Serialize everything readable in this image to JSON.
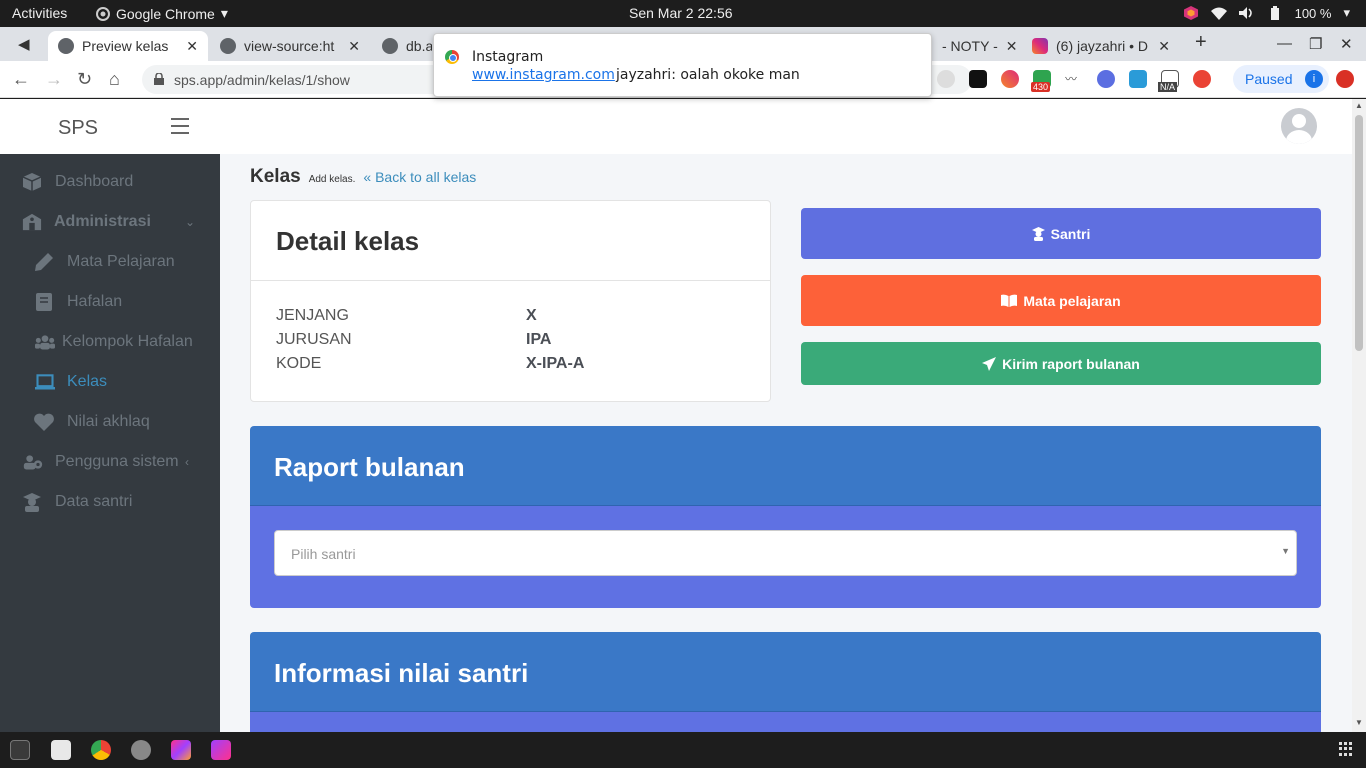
{
  "system": {
    "activities": "Activities",
    "app_name": "Google Chrome",
    "clock": "Sen Mar 2  22:56",
    "battery": "100 %"
  },
  "browser": {
    "tabs": [
      {
        "title": "Preview kelas",
        "active": true
      },
      {
        "title": "view-source:ht",
        "active": false
      },
      {
        "title": "db.a",
        "active": false
      },
      {
        "title": "- NOTY -",
        "active": false
      },
      {
        "title": "(6) jayzahri • D",
        "active": false
      }
    ],
    "url": "sps.app/admin/kelas/1/show",
    "paused_label": "Paused",
    "paused_badge": "i",
    "ext_badge_430": "430",
    "ext_badge_na": "N/A"
  },
  "notification": {
    "title": "Instagram",
    "source": "www.instagram.com",
    "message": "jayzahri: oalah okoke man"
  },
  "app": {
    "brand": "SPS",
    "sidebar": [
      {
        "label": "Dashboard",
        "icon": "box-icon"
      },
      {
        "label": "Administrasi",
        "icon": "school-icon"
      },
      {
        "label": "Mata Pelajaran",
        "icon": "pencil-icon"
      },
      {
        "label": "Hafalan",
        "icon": "book-icon"
      },
      {
        "label": "Kelompok Hafalan",
        "icon": "users-icon"
      },
      {
        "label": "Kelas",
        "icon": "laptop-icon"
      },
      {
        "label": "Nilai akhlaq",
        "icon": "heart-icon"
      },
      {
        "label": "Pengguna sistem",
        "icon": "users-cog-icon"
      },
      {
        "label": "Data santri",
        "icon": "graduate-icon"
      }
    ],
    "breadcrumb": {
      "title": "Kelas",
      "subtitle": "Add kelas.",
      "back": "Back to all kelas"
    },
    "detail": {
      "title": "Detail kelas",
      "rows": [
        {
          "label": "JENJANG",
          "value": "X"
        },
        {
          "label": "JURUSAN",
          "value": "IPA"
        },
        {
          "label": "KODE",
          "value": "X-IPA-A"
        }
      ]
    },
    "buttons": {
      "santri": "Santri",
      "mapel": "Mata pelajaran",
      "raport": "Kirim raport bulanan"
    },
    "raport_section": {
      "title": "Raport bulanan",
      "select_placeholder": "Pilih santri"
    },
    "nilai_section": {
      "title": "Informasi nilai santri"
    }
  },
  "colors": {
    "btn_santri": "#5f6fe0",
    "btn_mapel": "#fd6139",
    "btn_raport": "#3aaa79",
    "section_head": "#3a78c7",
    "section_body": "#5f71e3",
    "sidebar": "#343a40",
    "active_link": "#3c8dbc"
  }
}
